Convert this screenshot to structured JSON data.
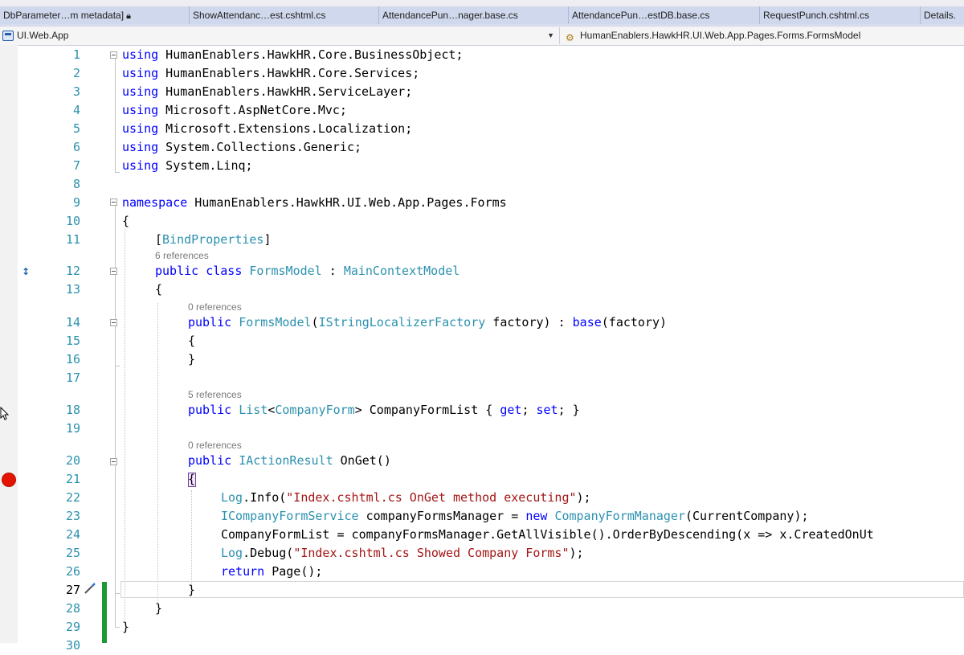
{
  "tabs": [
    {
      "label": "DbParameter…m metadata]",
      "locked": true
    },
    {
      "label": "ShowAttendanc…est.cshtml.cs"
    },
    {
      "label": "AttendancePun…nager.base.cs"
    },
    {
      "label": "AttendancePun…estDB.base.cs"
    },
    {
      "label": "RequestPunch.cshtml.cs"
    },
    {
      "label": "Details."
    }
  ],
  "navbar": {
    "project": "UI.Web.App",
    "member": "HumanEnablers.HawkHR.UI.Web.App.Pages.Forms.FormsModel"
  },
  "editor": {
    "line_numbers": [
      "1",
      "2",
      "3",
      "4",
      "5",
      "6",
      "7",
      "8",
      "9",
      "10",
      "11",
      "12",
      "13",
      "14",
      "15",
      "16",
      "17",
      "18",
      "19",
      "20",
      "21",
      "22",
      "23",
      "24",
      "25",
      "26",
      "27",
      "28",
      "29",
      "30"
    ],
    "references": {
      "class": "6 references",
      "ctor": "0 references",
      "prop": "5 references",
      "onget": "0 references"
    },
    "lines": {
      "l1_kw": "using",
      "l1_rest": " HumanEnablers.HawkHR.Core.BusinessObject;",
      "l2_kw": "using",
      "l2_rest": " HumanEnablers.HawkHR.Core.Services;",
      "l3_kw": "using",
      "l3_rest": " HumanEnablers.HawkHR.ServiceLayer;",
      "l4_kw": "using",
      "l4_rest": " Microsoft.AspNetCore.Mvc;",
      "l5_kw": "using",
      "l5_rest": " Microsoft.Extensions.Localization;",
      "l6_kw": "using",
      "l6_rest": " System.Collections.Generic;",
      "l7_kw": "using",
      "l7_rest": " System.Linq;",
      "l9_kw": "namespace",
      "l9_rest": " HumanEnablers.HawkHR.UI.Web.App.Pages.Forms",
      "l10": "{",
      "l11_open": "[",
      "l11_attr": "BindProperties",
      "l11_close": "]",
      "l12_kw1": "public",
      "l12_sp1": " ",
      "l12_kw2": "class",
      "l12_sp2": " ",
      "l12_t1": "FormsModel",
      "l12_mid": " : ",
      "l12_t2": "MainContextModel",
      "l13": "{",
      "l14_kw1": "public",
      "l14_sp1": " ",
      "l14_t1": "FormsModel",
      "l14_p1": "(",
      "l14_t2": "IStringLocalizerFactory",
      "l14_p2": " factory) : ",
      "l14_kw2": "base",
      "l14_p3": "(factory)",
      "l15": "{",
      "l16": "}",
      "l18_kw1": "public",
      "l18_sp1": " ",
      "l18_t1": "List",
      "l18_p1": "<",
      "l18_t2": "CompanyForm",
      "l18_p2": "> CompanyFormList { ",
      "l18_kw2": "get",
      "l18_p3": "; ",
      "l18_kw3": "set",
      "l18_p4": "; }",
      "l20_kw1": "public",
      "l20_sp1": " ",
      "l20_t1": "IActionResult",
      "l20_p1": " OnGet()",
      "l21": "{",
      "l22_t1": "Log",
      "l22_p1": ".Info(",
      "l22_s1": "\"Index.cshtml.cs OnGet method executing\"",
      "l22_p2": ");",
      "l23_t1": "ICompanyFormService",
      "l23_p1": " companyFormsManager = ",
      "l23_kw1": "new",
      "l23_sp1": " ",
      "l23_t2": "CompanyFormManager",
      "l23_p2": "(CurrentCompany);",
      "l24": "CompanyFormList = companyFormsManager.GetAllVisible().OrderByDescending(x => x.CreatedOnUt",
      "l25_t1": "Log",
      "l25_p1": ".Debug(",
      "l25_s1": "\"Index.cshtml.cs Showed Company Forms\"",
      "l25_p2": ");",
      "l26_kw1": "return",
      "l26_p1": " Page();",
      "l27": "}",
      "l28": "}",
      "l29": "}"
    }
  },
  "colors": {
    "keyword": "#0000ff",
    "type": "#2b91af",
    "string": "#a31515",
    "breakpoint": "#e51400",
    "change_bar": "#1a9a32"
  },
  "icons": [
    "lock-icon",
    "project-icon",
    "member-icon",
    "dropdown-arrow-icon",
    "bookmark-icon",
    "breakpoint-icon",
    "quick-actions-icon",
    "mouse-cursor-icon"
  ]
}
